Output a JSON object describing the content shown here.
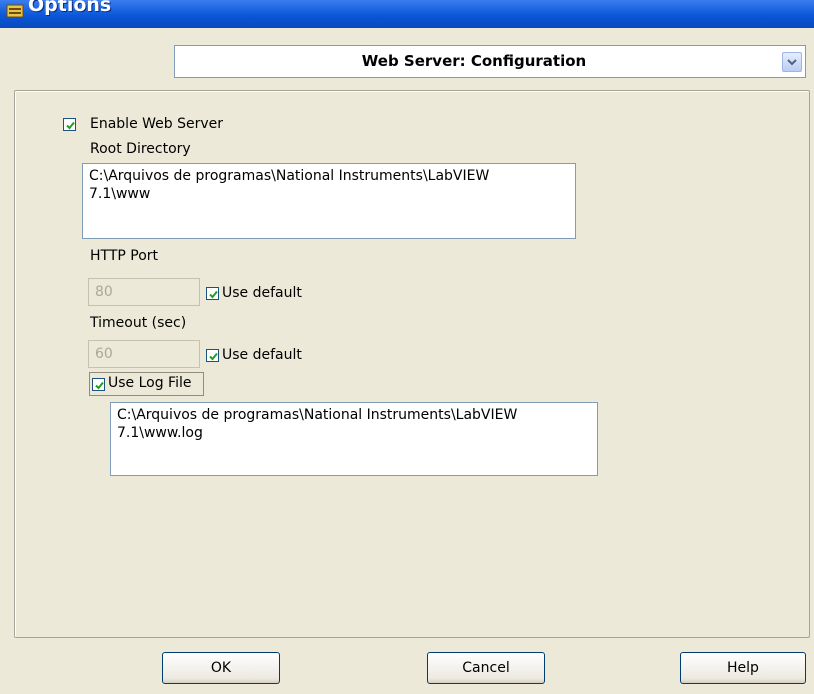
{
  "window": {
    "title": "Options",
    "icon": "labview-options-icon"
  },
  "category": {
    "selected": "Web Server: Configuration"
  },
  "web_server": {
    "enable_label": "Enable Web Server",
    "enable_checked": true,
    "root_directory_label": "Root Directory",
    "root_directory_lines": [
      "C:\\Arquivos de programas\\National Instruments\\LabVIEW",
      "7.1\\www"
    ],
    "http_port_label": "HTTP Port",
    "http_port_value": "80",
    "http_port_use_default_label": "Use default",
    "http_port_use_default_checked": true,
    "timeout_label": "Timeout (sec)",
    "timeout_value": "60",
    "timeout_use_default_label": "Use default",
    "timeout_use_default_checked": true,
    "use_log_file_label": "Use Log File",
    "use_log_file_checked": true,
    "log_file_lines": [
      "C:\\Arquivos de programas\\National Instruments\\LabVIEW",
      "7.1\\www.log"
    ]
  },
  "buttons": {
    "ok": "OK",
    "cancel": "Cancel",
    "help": "Help"
  },
  "colors": {
    "title_bar": "#0a57d8",
    "dialog_bg": "#ece9d8",
    "checkmark": "#21a121"
  }
}
